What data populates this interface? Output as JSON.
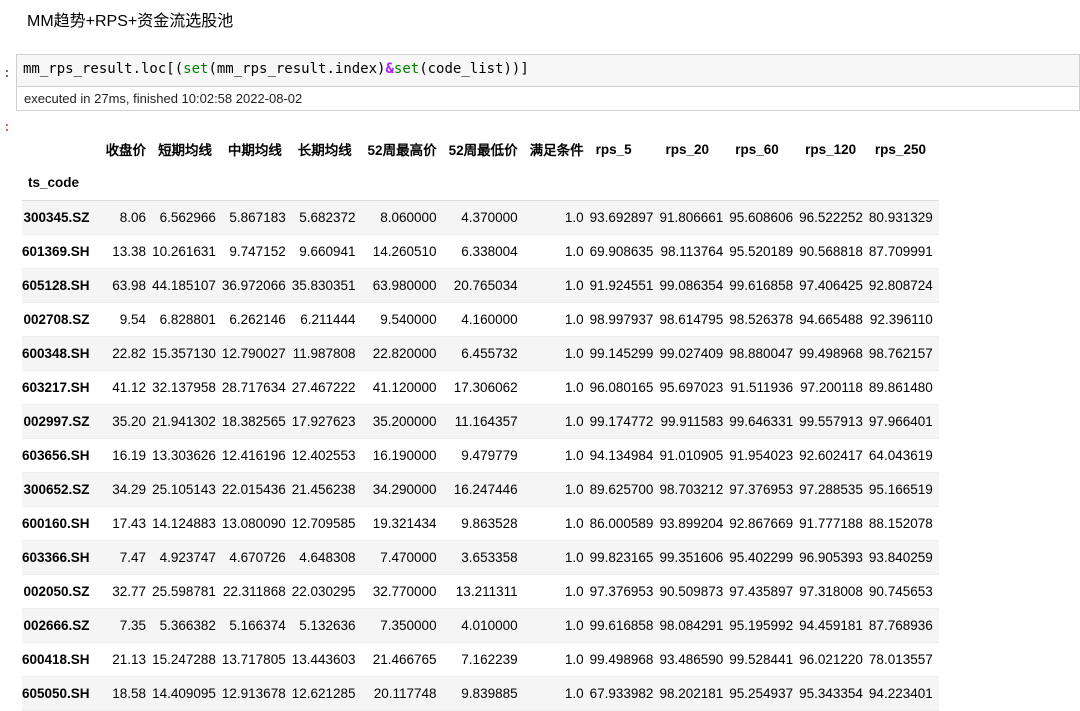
{
  "page": {
    "heading": "MM趋势+RPS+资金流选股池",
    "in_prompt": ":",
    "out_prompt": ":"
  },
  "code_cell": {
    "code_parts": [
      {
        "text": "mm_rps_result.loc[(",
        "kind": "name"
      },
      {
        "text": "set",
        "kind": "kw"
      },
      {
        "text": "(mm_rps_result.index)",
        "kind": "name"
      },
      {
        "text": "&",
        "kind": "op"
      },
      {
        "text": "set",
        "kind": "kw"
      },
      {
        "text": "(code_list))]",
        "kind": "name"
      }
    ],
    "exec_info": "executed in 27ms, finished 10:02:58 2022-08-02"
  },
  "table": {
    "index_name": "ts_code",
    "columns": [
      "收盘价",
      "短期均线",
      "中期均线",
      "长期均线",
      "52周最高价",
      "52周最低价",
      "满足条件",
      "rps_5",
      "rps_20",
      "rps_60",
      "rps_120",
      "rps_250"
    ],
    "rows": [
      {
        "index": "300345.SZ",
        "values": [
          "8.06",
          "6.562966",
          "5.867183",
          "5.682372",
          "8.060000",
          "4.370000",
          "1.0",
          "93.692897",
          "91.806661",
          "95.608606",
          "96.522252",
          "80.931329"
        ]
      },
      {
        "index": "601369.SH",
        "values": [
          "13.38",
          "10.261631",
          "9.747152",
          "9.660941",
          "14.260510",
          "6.338004",
          "1.0",
          "69.908635",
          "98.113764",
          "95.520189",
          "90.568818",
          "87.709991"
        ]
      },
      {
        "index": "605128.SH",
        "values": [
          "63.98",
          "44.185107",
          "36.972066",
          "35.830351",
          "63.980000",
          "20.765034",
          "1.0",
          "91.924551",
          "99.086354",
          "99.616858",
          "97.406425",
          "92.808724"
        ]
      },
      {
        "index": "002708.SZ",
        "values": [
          "9.54",
          "6.828801",
          "6.262146",
          "6.211444",
          "9.540000",
          "4.160000",
          "1.0",
          "98.997937",
          "98.614795",
          "98.526378",
          "94.665488",
          "92.396110"
        ]
      },
      {
        "index": "600348.SH",
        "values": [
          "22.82",
          "15.357130",
          "12.790027",
          "11.987808",
          "22.820000",
          "6.455732",
          "1.0",
          "99.145299",
          "99.027409",
          "98.880047",
          "99.498968",
          "98.762157"
        ]
      },
      {
        "index": "603217.SH",
        "values": [
          "41.12",
          "32.137958",
          "28.717634",
          "27.467222",
          "41.120000",
          "17.306062",
          "1.0",
          "96.080165",
          "95.697023",
          "91.511936",
          "97.200118",
          "89.861480"
        ]
      },
      {
        "index": "002997.SZ",
        "values": [
          "35.20",
          "21.941302",
          "18.382565",
          "17.927623",
          "35.200000",
          "11.164357",
          "1.0",
          "99.174772",
          "99.911583",
          "99.646331",
          "99.557913",
          "97.966401"
        ]
      },
      {
        "index": "603656.SH",
        "values": [
          "16.19",
          "13.303626",
          "12.416196",
          "12.402553",
          "16.190000",
          "9.479779",
          "1.0",
          "94.134984",
          "91.010905",
          "91.954023",
          "92.602417",
          "64.043619"
        ]
      },
      {
        "index": "300652.SZ",
        "values": [
          "34.29",
          "25.105143",
          "22.015436",
          "21.456238",
          "34.290000",
          "16.247446",
          "1.0",
          "89.625700",
          "98.703212",
          "97.376953",
          "97.288535",
          "95.166519"
        ]
      },
      {
        "index": "600160.SH",
        "values": [
          "17.43",
          "14.124883",
          "13.080090",
          "12.709585",
          "19.321434",
          "9.863528",
          "1.0",
          "86.000589",
          "93.899204",
          "92.867669",
          "91.777188",
          "88.152078"
        ]
      },
      {
        "index": "603366.SH",
        "values": [
          "7.47",
          "4.923747",
          "4.670726",
          "4.648308",
          "7.470000",
          "3.653358",
          "1.0",
          "99.823165",
          "99.351606",
          "95.402299",
          "96.905393",
          "93.840259"
        ]
      },
      {
        "index": "002050.SZ",
        "values": [
          "32.77",
          "25.598781",
          "22.311868",
          "22.030295",
          "32.770000",
          "13.211311",
          "1.0",
          "97.376953",
          "90.509873",
          "97.435897",
          "97.318008",
          "90.745653"
        ]
      },
      {
        "index": "002666.SZ",
        "values": [
          "7.35",
          "5.366382",
          "5.166374",
          "5.132636",
          "7.350000",
          "4.010000",
          "1.0",
          "99.616858",
          "98.084291",
          "95.195992",
          "94.459181",
          "87.768936"
        ]
      },
      {
        "index": "600418.SH",
        "values": [
          "21.13",
          "15.247288",
          "13.717805",
          "13.443603",
          "21.466765",
          "7.162239",
          "1.0",
          "99.498968",
          "93.486590",
          "99.528441",
          "96.021220",
          "78.013557"
        ]
      },
      {
        "index": "605050.SH",
        "values": [
          "18.58",
          "14.409095",
          "12.913678",
          "12.621285",
          "20.117748",
          "9.839885",
          "1.0",
          "67.933982",
          "98.202181",
          "95.254937",
          "95.343354",
          "94.223401"
        ]
      }
    ]
  }
}
